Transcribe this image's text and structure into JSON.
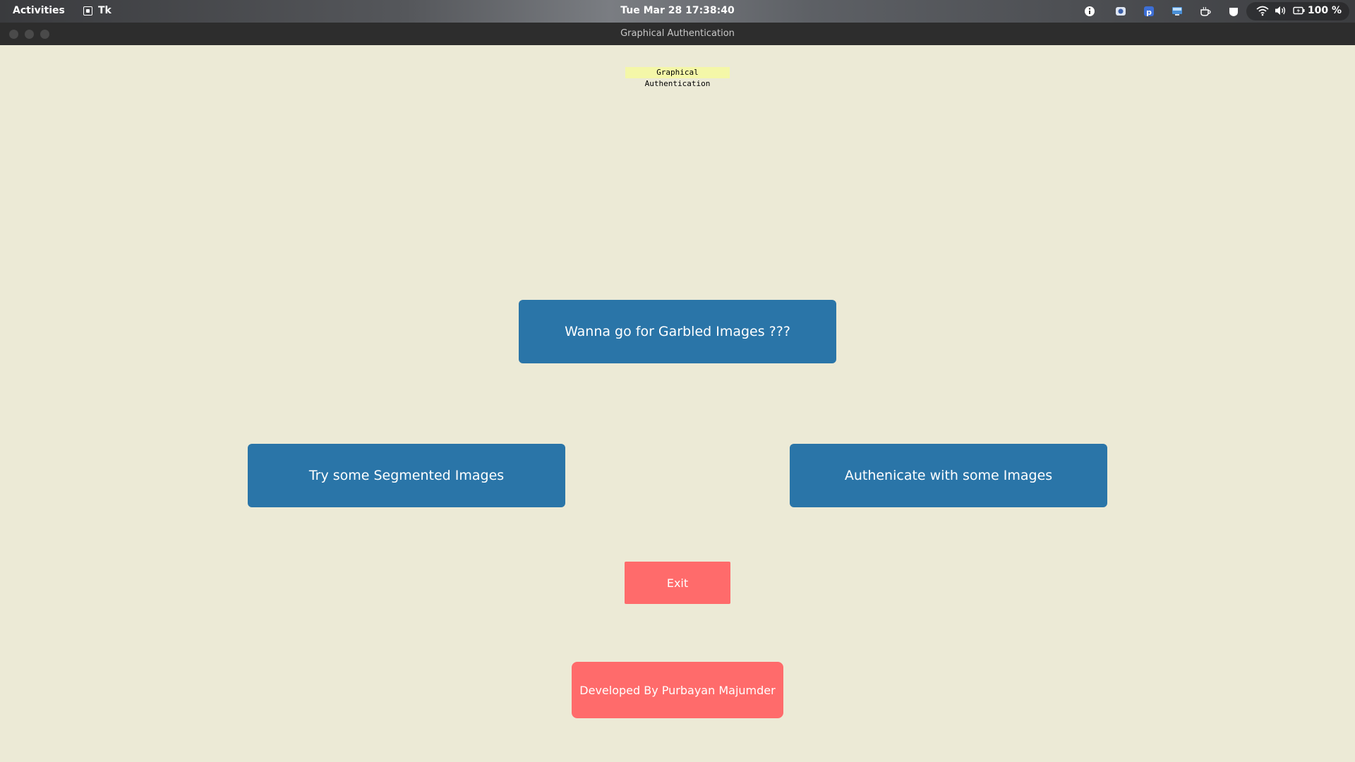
{
  "topbar": {
    "activities": "Activities",
    "app_name": "Tk",
    "clock": "Tue Mar 28  17:38:40",
    "battery_percent": "100 %",
    "tray_icons": [
      "info-icon",
      "screenshot-icon",
      "pastebin-icon",
      "display-icon",
      "coffee-icon",
      "shield-icon"
    ],
    "system_icons": [
      "wifi-icon",
      "volume-icon",
      "battery-icon"
    ]
  },
  "window": {
    "title": "Graphical Authentication",
    "controls": [
      "close",
      "minimize",
      "maximize"
    ]
  },
  "app": {
    "title_label": "Graphical Authentication",
    "garbled_button": "Wanna go for Garbled Images ???",
    "segmented_button": "Try some Segmented Images",
    "authenticate_button": "Authenicate with some Images",
    "exit_button": "Exit",
    "credit_button": "Developed By Purbayan Majumder"
  },
  "colors": {
    "background": "#ECEAD6",
    "primary_button": "#2A75A8",
    "secondary_button": "#FF6B6B",
    "title_label_bg": "#F4F7A8"
  }
}
